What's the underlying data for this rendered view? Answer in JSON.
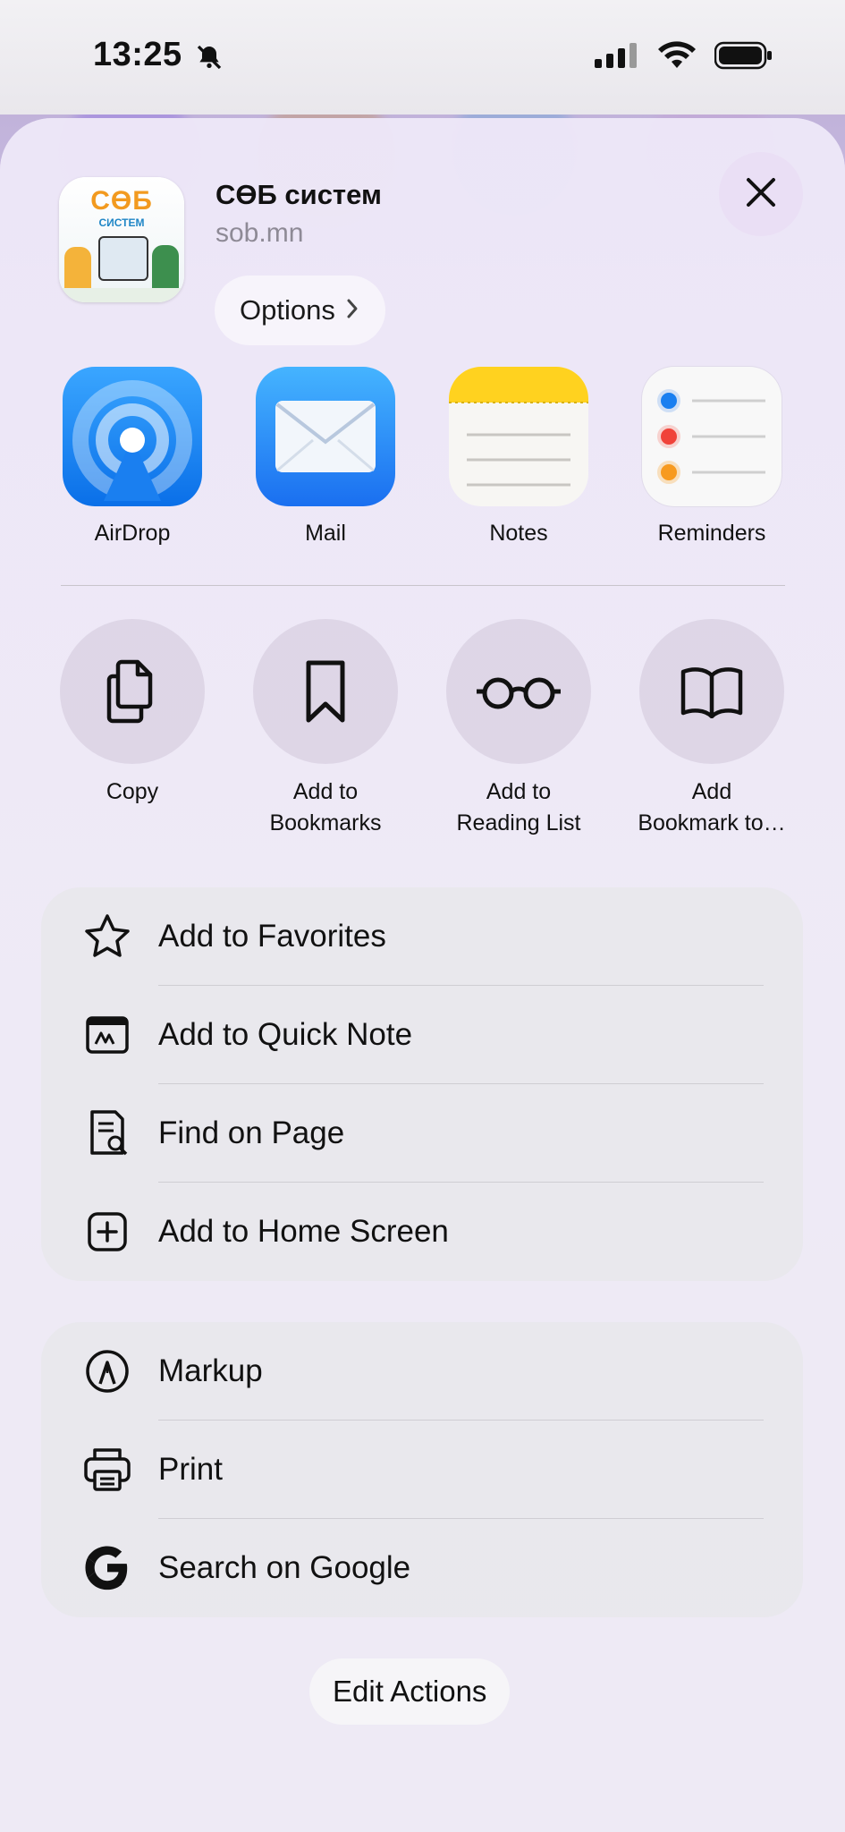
{
  "status_bar": {
    "time": "13:25"
  },
  "share_header": {
    "site_title": "СӨБ систем",
    "site_url": "sob.mn",
    "thumb_logo_text": "СӨБ",
    "thumb_subtitle": "СИСТЕМ",
    "options_label": "Options"
  },
  "apps": [
    {
      "label": "AirDrop",
      "icon": "airdrop-icon"
    },
    {
      "label": "Mail",
      "icon": "mail-icon"
    },
    {
      "label": "Notes",
      "icon": "notes-icon"
    },
    {
      "label": "Reminders",
      "icon": "reminders-icon"
    }
  ],
  "actions": [
    {
      "label": "Copy",
      "icon": "copy-icon"
    },
    {
      "label": "Add to\nBookmarks",
      "icon": "bookmark-icon"
    },
    {
      "label": "Add to\nReading List",
      "icon": "glasses-icon"
    },
    {
      "label": "Add\nBookmark to…",
      "icon": "book-icon"
    }
  ],
  "list_group_1": [
    {
      "label": "Add to Favorites",
      "icon": "star-icon"
    },
    {
      "label": "Add to Quick Note",
      "icon": "quick-note-icon"
    },
    {
      "label": "Find on Page",
      "icon": "find-on-page-icon"
    },
    {
      "label": "Add to Home Screen",
      "icon": "add-square-icon"
    }
  ],
  "list_group_2": [
    {
      "label": "Markup",
      "icon": "markup-icon"
    },
    {
      "label": "Print",
      "icon": "printer-icon"
    },
    {
      "label": "Search on Google",
      "icon": "google-icon"
    }
  ],
  "footer": {
    "edit_actions_label": "Edit Actions"
  },
  "colors": {
    "airdrop_blue": "#1a8cf5",
    "mail_blue": "#2f8ff0",
    "notes_yellow": "#ffd21f",
    "sheet_bg": "#efebf6"
  }
}
